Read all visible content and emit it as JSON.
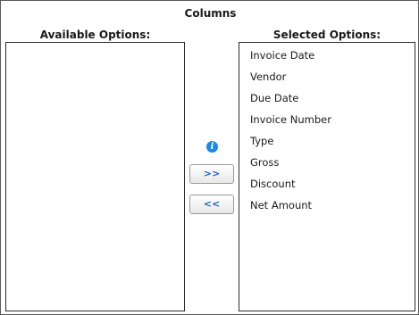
{
  "panel": {
    "title": "Columns",
    "available_header": "Available Options:",
    "selected_header": "Selected Options:"
  },
  "available_options": [],
  "selected_options": [
    "Invoice Date",
    "Vendor",
    "Due Date",
    "Invoice Number",
    "Type",
    "Gross",
    "Discount",
    "Net Amount"
  ],
  "buttons": {
    "add_label": ">>",
    "remove_label": "<<"
  },
  "icons": {
    "info": "info-icon",
    "info_glyph": "i"
  },
  "colors": {
    "accent": "#1e88e5",
    "button_text": "#1565c0"
  }
}
